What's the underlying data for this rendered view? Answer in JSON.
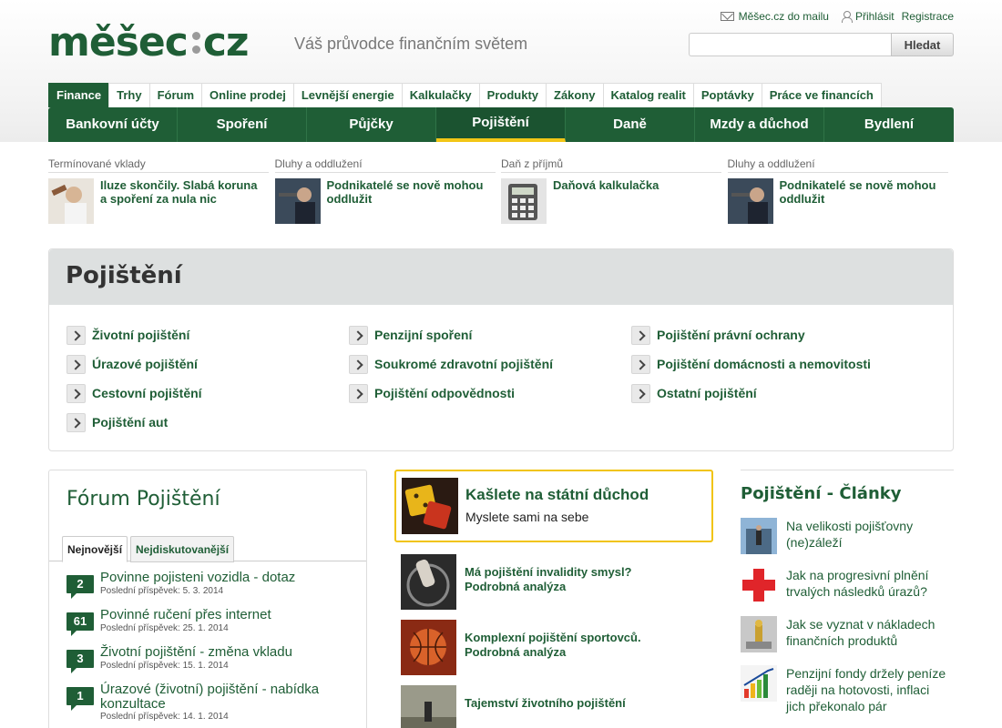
{
  "logo": {
    "left": "měšec",
    "right": "cz"
  },
  "tagline": "Váš průvodce finančním světem",
  "toplinks": {
    "mail": "Měšec.cz do mailu",
    "login": "Přihlásit",
    "register": "Registrace"
  },
  "search": {
    "placeholder": "",
    "button": "Hledat"
  },
  "toptabs": [
    "Finance",
    "Trhy",
    "Fórum",
    "Online prodej",
    "Levnější energie",
    "Kalkulačky",
    "Produkty",
    "Zákony",
    "Katalog realit",
    "Poptávky",
    "Práce ve financích"
  ],
  "mainnav": [
    "Bankovní účty",
    "Spoření",
    "Půjčky",
    "Pojištění",
    "Daně",
    "Mzdy a důchod",
    "Bydlení"
  ],
  "featured": [
    {
      "category": "Termínované vklady",
      "title": "Iluze skončily. Slabá koruna a spoření za nula nic"
    },
    {
      "category": "Dluhy a oddlužení",
      "title": "Podnikatelé se nově mohou oddlužit"
    },
    {
      "category": "Daň z příjmů",
      "title": "Daňová kalkulačka"
    },
    {
      "category": "Dluhy a oddlužení",
      "title": "Podnikatelé se nově mohou oddlužit"
    }
  ],
  "section": {
    "title": "Pojištění",
    "links": [
      "Životní pojištění",
      "Úrazové pojištění",
      "Cestovní pojištění",
      "Pojištění aut",
      "Penzijní spoření",
      "Soukromé zdravotní pojištění",
      "Pojištění odpovědnosti",
      "Pojištění právní ochrany",
      "Pojištění domácnosti a nemovitosti",
      "Ostatní pojištění"
    ]
  },
  "forum": {
    "title": "Fórum Pojištění",
    "tabs": [
      "Nejnovější",
      "Nejdiskutovanější"
    ],
    "topics": [
      {
        "count": "2",
        "title": "Povinne pojisteni vozidla - dotaz",
        "meta": "Poslední příspěvek: 5. 3. 2014"
      },
      {
        "count": "61",
        "title": "Povinné ručení přes internet",
        "meta": "Poslední příspěvek: 25. 1. 2014"
      },
      {
        "count": "3",
        "title": "Životní pojištění - změna vkladu",
        "meta": "Poslední příspěvek: 15. 1. 2014"
      },
      {
        "count": "1",
        "title": "Úrazové (životní) pojištění - nabídka konzultace",
        "meta": "Poslední příspěvek: 14. 1. 2014"
      }
    ]
  },
  "promo": {
    "title": "Kašlete na státní důchod",
    "subtitle": "Myslete sami na sebe"
  },
  "middle": [
    "Má pojištění invalidity smysl? Podrobná analýza",
    "Komplexní pojištění sportovců. Podrobná analýza",
    "Tajemství životního pojištění"
  ],
  "articles": {
    "title": "Pojištění - Články",
    "items": [
      "Na velikosti pojišťovny (ne)záleží",
      "Jak na progresivní plnění trvalých následků úrazů?",
      "Jak se vyznat v nákladech finančních produktů",
      "Penzijní fondy držely peníze raději na hotovosti, inflaci jich překonalo pár"
    ]
  }
}
